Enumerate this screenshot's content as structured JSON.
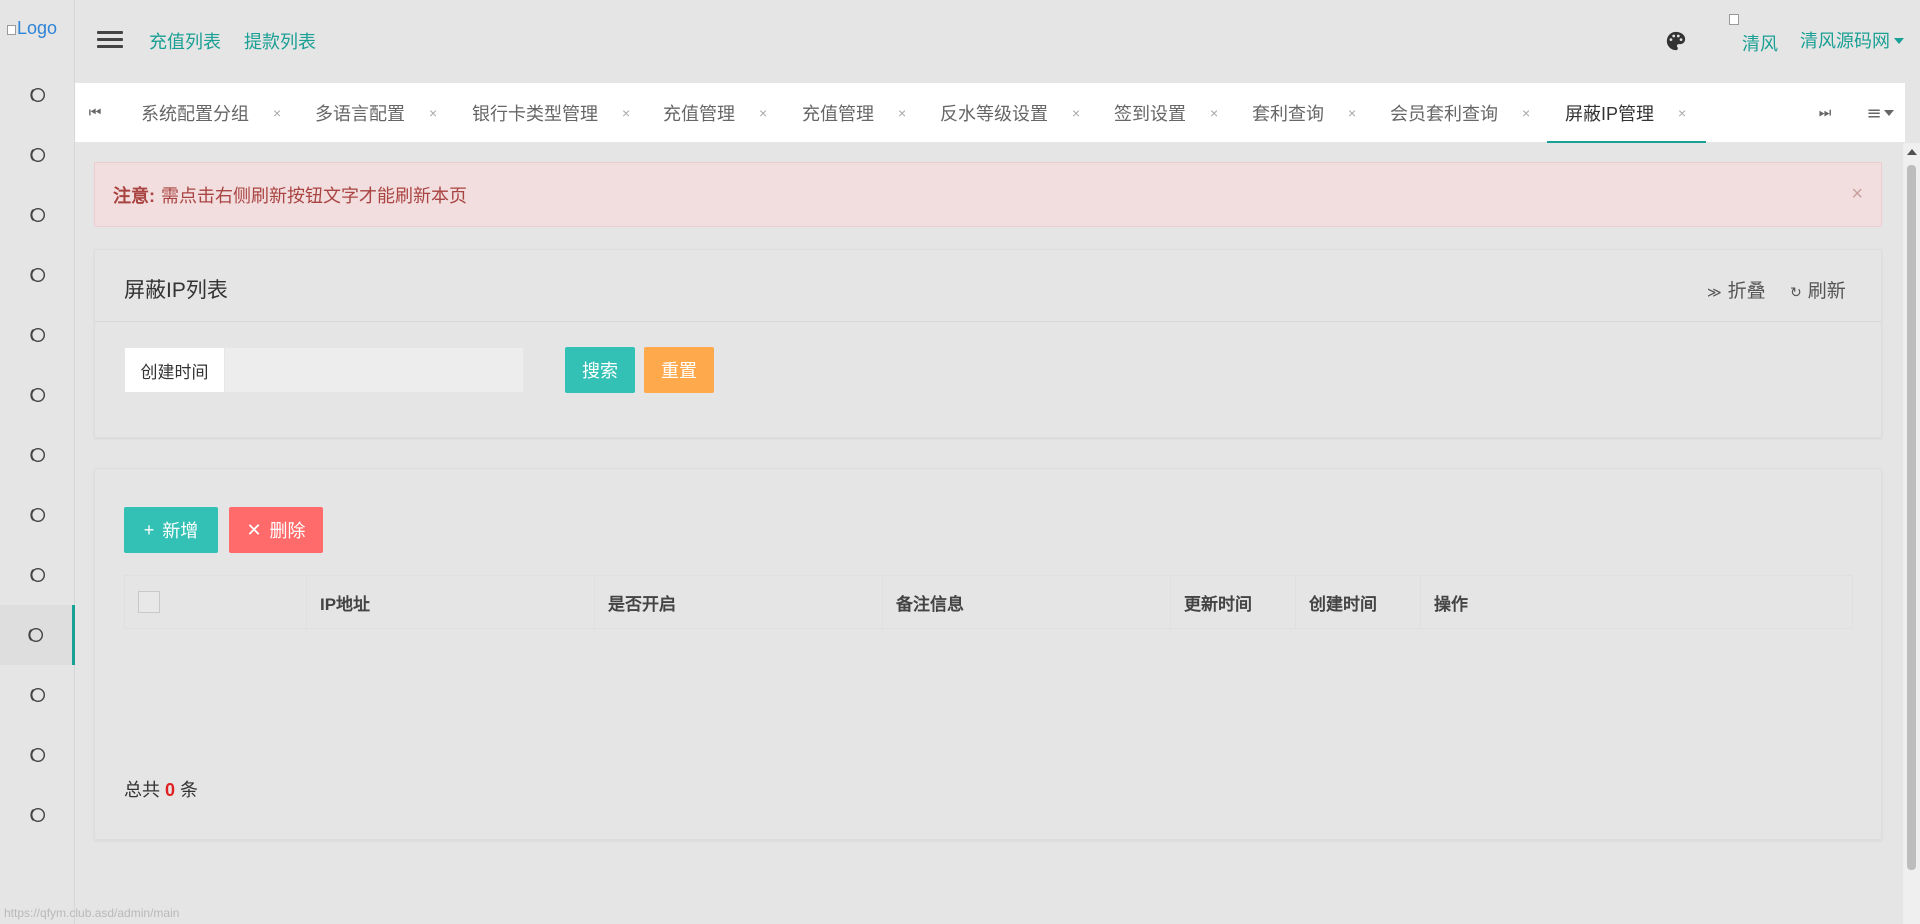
{
  "sidebar": {
    "logo_alt": "Logo",
    "items": [
      {
        "icon": "circle-o-icon",
        "active": false
      },
      {
        "icon": "circle-o-icon",
        "active": false
      },
      {
        "icon": "circle-o-icon",
        "active": false
      },
      {
        "icon": "circle-o-icon",
        "active": false
      },
      {
        "icon": "circle-o-icon",
        "active": false
      },
      {
        "icon": "circle-o-icon",
        "active": false
      },
      {
        "icon": "circle-o-icon",
        "active": false
      },
      {
        "icon": "circle-o-icon",
        "active": false
      },
      {
        "icon": "circle-o-icon",
        "active": false
      },
      {
        "icon": "circle-o-icon",
        "active": true
      },
      {
        "icon": "circle-o-icon",
        "active": false
      },
      {
        "icon": "circle-o-icon",
        "active": false
      },
      {
        "icon": "circle-o-icon",
        "active": false
      }
    ]
  },
  "header": {
    "links": [
      "充值列表",
      "提款列表"
    ],
    "user_img_alt": "清风",
    "user_name": "清风源码网"
  },
  "tabs": {
    "items": [
      {
        "label": "系统配置分组",
        "active": false
      },
      {
        "label": "多语言配置",
        "active": false
      },
      {
        "label": "银行卡类型管理",
        "active": false
      },
      {
        "label": "充值管理",
        "active": false
      },
      {
        "label": "充值管理",
        "active": false
      },
      {
        "label": "反水等级设置",
        "active": false
      },
      {
        "label": "签到设置",
        "active": false
      },
      {
        "label": "套利查询",
        "active": false
      },
      {
        "label": "会员套利查询",
        "active": false
      },
      {
        "label": "屏蔽IP管理",
        "active": true
      }
    ],
    "close_glyph": "×"
  },
  "alert": {
    "label": "注意:",
    "text": "需点击右侧刷新按钮文字才能刷新本页",
    "close": "×"
  },
  "search_card": {
    "title": "屏蔽IP列表",
    "collapse_label": "折叠",
    "refresh_label": "刷新",
    "field_label": "创建时间",
    "field_value": "",
    "search_button": "搜索",
    "reset_button": "重置"
  },
  "list_card": {
    "add_button": "新增",
    "delete_button": "删除",
    "columns": [
      "IP地址",
      "是否开启",
      "备注信息",
      "更新时间",
      "创建时间",
      "操作"
    ],
    "total_prefix": "总共",
    "total_count": "0",
    "total_suffix": "条"
  },
  "status_url": "https://qfym.club.asd/admin/main",
  "colors": {
    "accent": "#1aa094",
    "primary_button": "#33c1b5",
    "warm_button": "#ffa94d",
    "danger_button": "#ff6b6b",
    "alert_bg": "#f2dede",
    "alert_text": "#a94442"
  }
}
